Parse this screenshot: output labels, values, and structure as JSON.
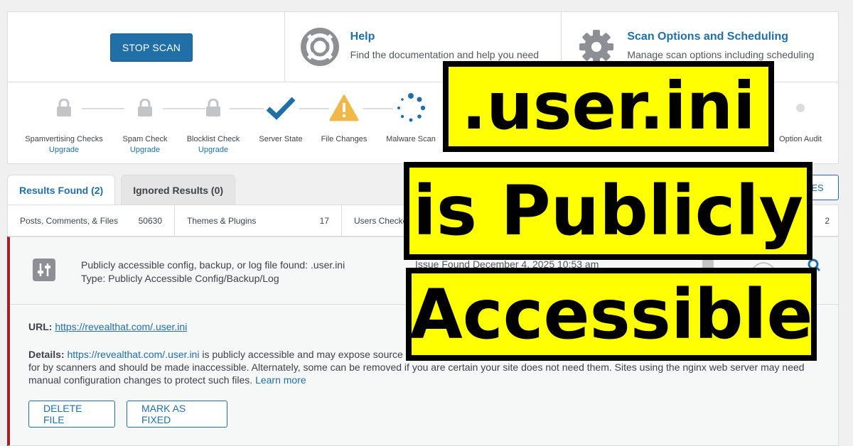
{
  "top": {
    "stop_scan_label": "STOP SCAN",
    "help": {
      "title": "Help",
      "desc": "Find the documentation and help you need",
      "icon": "lifebuoy-icon"
    },
    "scan_options": {
      "title": "Scan Options and Scheduling",
      "desc": "Manage scan options including scheduling",
      "icon": "gear-icon"
    }
  },
  "steps": [
    {
      "label": "Spamvertising Checks",
      "link": "Upgrade",
      "state": "locked"
    },
    {
      "label": "Spam Check",
      "link": "Upgrade",
      "state": "locked"
    },
    {
      "label": "Blocklist Check",
      "link": "Upgrade",
      "state": "locked"
    },
    {
      "label": "Server State",
      "link": "",
      "state": "done"
    },
    {
      "label": "File Changes",
      "link": "",
      "state": "warning"
    },
    {
      "label": "Malware Scan",
      "link": "",
      "state": "running"
    },
    {
      "label": "Option Audit",
      "link": "",
      "state": "pending"
    }
  ],
  "tabs": {
    "results": "Results Found (2)",
    "ignored": "Ignored Results (0)"
  },
  "right_button_partial": "ES",
  "stats": [
    {
      "label": "Posts, Comments, & Files",
      "value": "50630"
    },
    {
      "label": "Themes & Plugins",
      "value": "17"
    },
    {
      "label": "Users Checked",
      "value": ""
    }
  ],
  "stats_last_value": "2",
  "issue": {
    "title": "Publicly accessible config, backup, or log file found: .user.ini",
    "type": "Type: Publicly Accessible Config/Backup/Log",
    "date": "Issue Found December 4, 2025 10:53 am",
    "url_label": "URL:",
    "url": "https://revealthat.com/.user.ini",
    "details_label": "Details:",
    "details_link": "https://revealthat.com/.user.ini",
    "details_text_1": " is publicly accessible and may expose source",
    "details_text_2": "for by scanners and should be made inaccessible. Alternately, some can be removed if you are certain your site does not need them. Sites using the nginx web server may need",
    "details_text_3": "manual configuration changes to protect such files. ",
    "learn_more": "Learn more",
    "delete_label": "DELETE FILE",
    "fixed_label": "MARK AS FIXED"
  },
  "overlay": {
    "line1": ".user.ini",
    "line2": "is Publicly",
    "line3": "Accessible"
  },
  "colors": {
    "accent": "#216fa7",
    "critical": "#a51d26",
    "warning": "#f0b849",
    "overlay_bg": "#ffff00"
  }
}
